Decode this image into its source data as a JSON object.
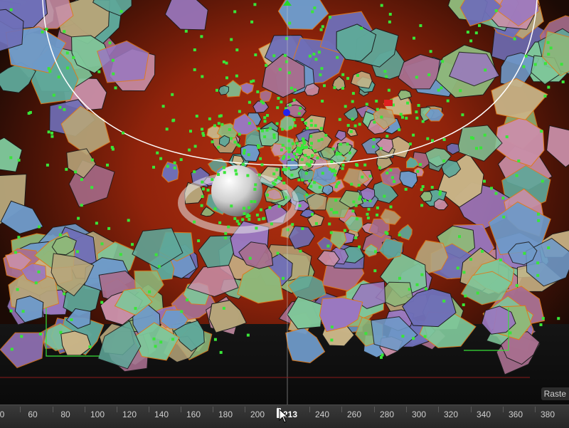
{
  "viewport": {
    "render_mode_label": "Raste",
    "colors": {
      "background": "#8f230b",
      "floor": "#111111",
      "selection_outline": "#e07a1a",
      "particles": "#39e639",
      "guide_circle": "#ffffff",
      "axis_y": "#27d927",
      "axis_x": "#e02020",
      "axis_z": "#2222ee",
      "fragment_palette": [
        "#6f6fb8",
        "#8fb87a",
        "#c98fa8",
        "#5fa89a",
        "#b6a57a",
        "#9a78c0",
        "#7fc79a",
        "#a86f8f",
        "#6f9ac9",
        "#c9b487"
      ]
    }
  },
  "timeline": {
    "ticks": [
      "0",
      "60",
      "80",
      "100",
      "120",
      "140",
      "160",
      "180",
      "200",
      "213",
      "240",
      "260",
      "280",
      "300",
      "320",
      "340",
      "360",
      "380"
    ],
    "current_frame": "213"
  }
}
